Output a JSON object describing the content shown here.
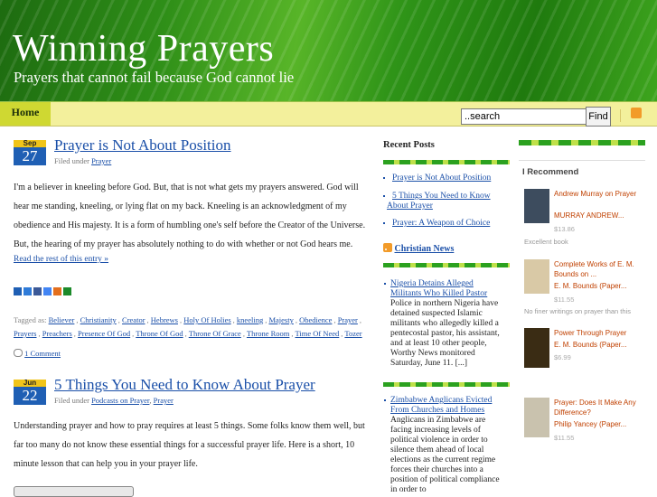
{
  "header": {
    "title": "Winning Prayers",
    "tagline": "Prayers that cannot fail because God cannot lie"
  },
  "nav": {
    "home": "Home",
    "search_value": "..search",
    "find_label": "Find"
  },
  "posts": [
    {
      "month": "Sep",
      "day": "27",
      "title": "Prayer is Not About Position",
      "filed_prefix": "Filed under",
      "category": "Prayer",
      "body": "I'm a believer in kneeling before God. But, that is not what gets my prayers answered. God will hear me standing, kneeling, or lying flat on my back. Kneeling is an acknowledgment of my obedience and His majesty. It is a form of humbling one's self before the Creator of the Universe. But, the hearing of my prayer has absolutely nothing to do with whether or not God hears me.",
      "read_more": "Read the rest of this entry »",
      "tagged_as": "Tagged as:",
      "tags": [
        "Believer",
        "Christianity",
        "Creator",
        "Hebrews",
        "Holy Of Holies",
        "kneeling",
        "Majesty",
        "Obedience",
        "Prayer",
        "Prayers",
        "Preachers",
        "Presence Of God",
        "Throne Of God",
        "Throne Of Grace",
        "Throne Room",
        "Time Of Need",
        "Tozer"
      ],
      "comments": "1 Comment"
    },
    {
      "month": "Jun",
      "day": "22",
      "title": "5 Things You Need to Know About Prayer",
      "filed_prefix": "Filed under",
      "category": "Podcasts on Prayer",
      "category2": "Prayer",
      "body": "Understanding prayer and how to pray  requires at least 5 things. Some folks know them well, but far too many do not know these essential things for a successful prayer life. Here is a short, 10 minute lesson that can help you in your prayer life."
    }
  ],
  "recent_posts": {
    "heading": "Recent Posts",
    "items": [
      "Prayer is Not About Position",
      "5 Things You Need to Know About Prayer",
      "Prayer: A Weapon of Choice"
    ]
  },
  "christian_news": {
    "heading": "Christian News",
    "items": [
      {
        "title": "Nigeria Detains Alleged Militants Who Killed Pastor",
        "summary": "Police in northern Nigeria have detained suspected Islamic militants who allegedly killed a pentecostal pastor, his assistant, and at least 10 other people, Worthy News monitored Saturday, June 11. [...]"
      },
      {
        "title": "Zimbabwe Anglicans Evicted From Churches and Homes",
        "summary": "Anglicans in Zimbabwe are facing increasing levels of political violence in order to silence them ahead of local elections as the current regime forces their churches into a position of political compliance in order to"
      }
    ]
  },
  "recommend": {
    "heading": "I Recommend",
    "books": [
      {
        "title": "Andrew Murray on Prayer",
        "author": "MURRAY ANDREW...",
        "price": "$13.86",
        "note": "Excellent book",
        "cover_color": "#3d4c5e"
      },
      {
        "title": "Complete Works of E. M. Bounds on ...",
        "author": "E. M. Bounds (Paper...",
        "price": "$11.55",
        "note": "No finer writings on prayer than this",
        "cover_color": "#d9c9a6"
      },
      {
        "title": "Power Through Prayer",
        "author": "E. M. Bounds (Paper...",
        "price": "$6.99",
        "note": "",
        "cover_color": "#3a2c14"
      },
      {
        "title": "Prayer: Does It Make Any Difference?",
        "author": "Philip Yancey (Paper...",
        "price": "$11.55",
        "note": "",
        "cover_color": "#c9c2ae"
      }
    ]
  }
}
